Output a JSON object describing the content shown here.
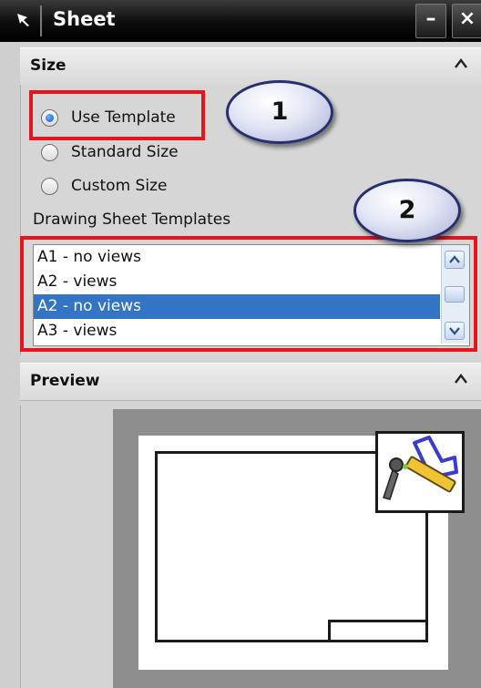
{
  "window": {
    "title": "Sheet",
    "minimize_label": "–",
    "close_label": "×"
  },
  "size_group": {
    "title": "Size",
    "options": [
      {
        "label": "Use Template",
        "selected": true
      },
      {
        "label": "Standard Size",
        "selected": false
      },
      {
        "label": "Custom Size",
        "selected": false
      }
    ],
    "templates_label": "Drawing Sheet Templates",
    "templates": [
      {
        "label": "A1 - no views",
        "selected": false
      },
      {
        "label": "A2 - views",
        "selected": false
      },
      {
        "label": "A2 - no views",
        "selected": true
      },
      {
        "label": "A3 - views",
        "selected": false
      }
    ]
  },
  "preview_group": {
    "title": "Preview"
  },
  "callouts": {
    "first": "1",
    "second": "2"
  },
  "colors": {
    "highlight": "#e8141c",
    "selection": "#3374c6",
    "callout_border": "#27306e"
  },
  "icons": [
    "pin-icon",
    "chevron-up-icon",
    "scroll-up-icon",
    "scroll-down-icon",
    "drafting-tool-icon"
  ]
}
